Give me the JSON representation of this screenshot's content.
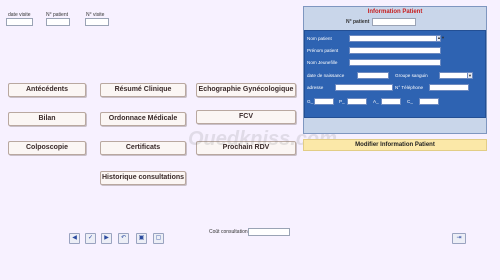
{
  "header": {
    "date_visite_label": "date visite",
    "n_patient_label": "N° patient",
    "n_visite_label": "N° visite",
    "date_visite_value": "",
    "n_patient_value": "",
    "n_visite_value": ""
  },
  "buttons": {
    "antecedents": "Antécédents",
    "resume_clinique": "Résumé Clinique",
    "echographie": "Echographie  Gynécologique",
    "bilan": "Bilan",
    "ordonnace": "Ordonnace Médicale",
    "fcv": "FCV",
    "colposcopie": "Colposcopie",
    "certificats": "Certificats",
    "prochain_rdv": "Prochain RDV",
    "historique": "Historique consultations"
  },
  "patient_panel": {
    "title": "Information Patient",
    "n_patient_label": "N° patient",
    "nom_patient_label": "Nom patient",
    "prenom_patient_label": "Prénom patient",
    "nom_jeune_fille_label": "Nom Jeunefille",
    "date_naissance_label": "date de naissance",
    "groupe_sanguin_label": "Groupe sanguin",
    "adresse_label": "adresse",
    "telephone_label": "N° Téléphone",
    "g_label": "G_",
    "p_label": "P_",
    "a_label": "A_",
    "c_label": "C_"
  },
  "modify_button": "Modifier Information Patient",
  "footer": {
    "cout_label": "Coût consultation",
    "cout_value": ""
  },
  "watermark": "Ouedkniss.com",
  "nav_icons": [
    "first-record-icon",
    "previous-record-icon",
    "next-record-icon",
    "undo-icon",
    "new-record-icon",
    "delete-record-icon"
  ]
}
